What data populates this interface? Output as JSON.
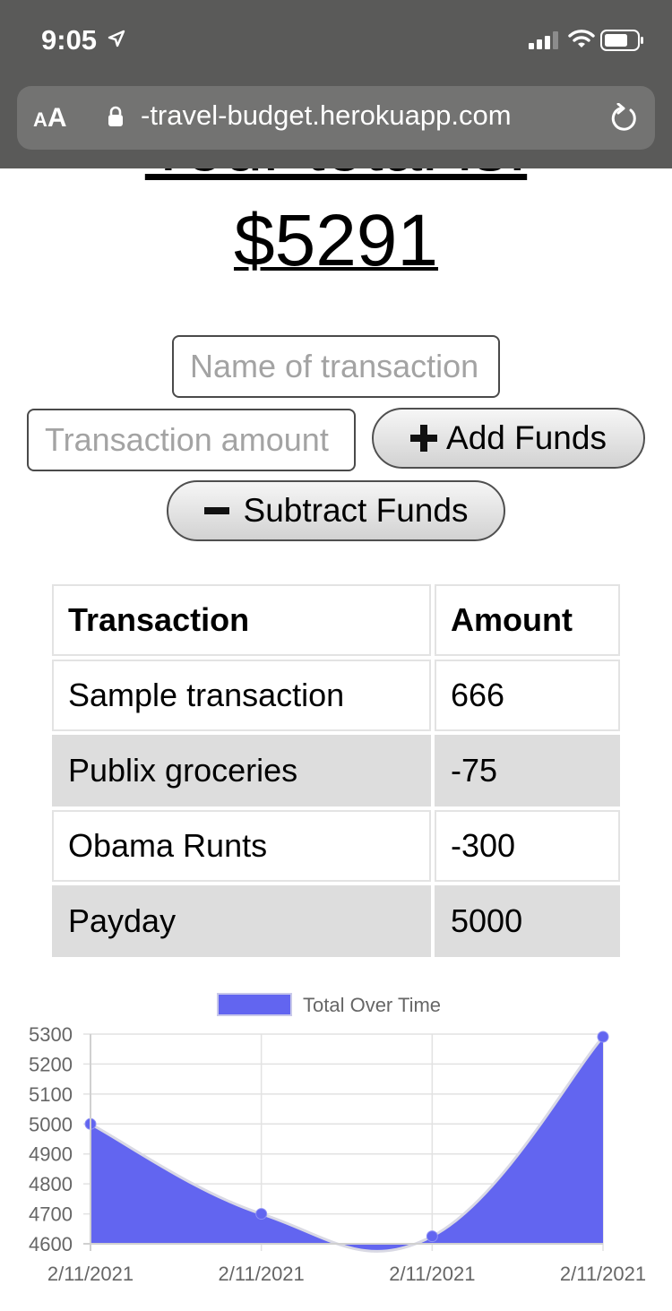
{
  "status_bar": {
    "time": "9:05"
  },
  "browser": {
    "aa_small": "A",
    "aa_big": "A",
    "url": "-travel-budget.herokuapp.com"
  },
  "page": {
    "heading": "Your total is:",
    "total": "$5291"
  },
  "form": {
    "name_placeholder": "Name of transaction",
    "amount_placeholder": "Transaction amount",
    "add_label": "Add Funds",
    "subtract_label": "Subtract Funds"
  },
  "table": {
    "headers": [
      "Transaction",
      "Amount"
    ],
    "rows": [
      {
        "name": "Sample transaction",
        "amount": "666"
      },
      {
        "name": "Publix groceries",
        "amount": "-75"
      },
      {
        "name": "Obama Runts",
        "amount": "-300"
      },
      {
        "name": "Payday",
        "amount": "5000"
      }
    ]
  },
  "chart_data": {
    "type": "area",
    "legend": "Total Over Time",
    "legend_position": "top",
    "x": [
      "2/11/2021",
      "2/11/2021",
      "2/11/2021",
      "2/11/2021"
    ],
    "series": [
      {
        "name": "Total Over Time",
        "values": [
          5000,
          4700,
          4625,
          5291
        ]
      }
    ],
    "ylim": [
      4600,
      5300
    ],
    "yticks": [
      5300,
      5200,
      5100,
      5000,
      4900,
      4800,
      4700,
      4600
    ],
    "grid": true,
    "fill_color": "#6265f0",
    "line_color": "#d9d9e4"
  }
}
